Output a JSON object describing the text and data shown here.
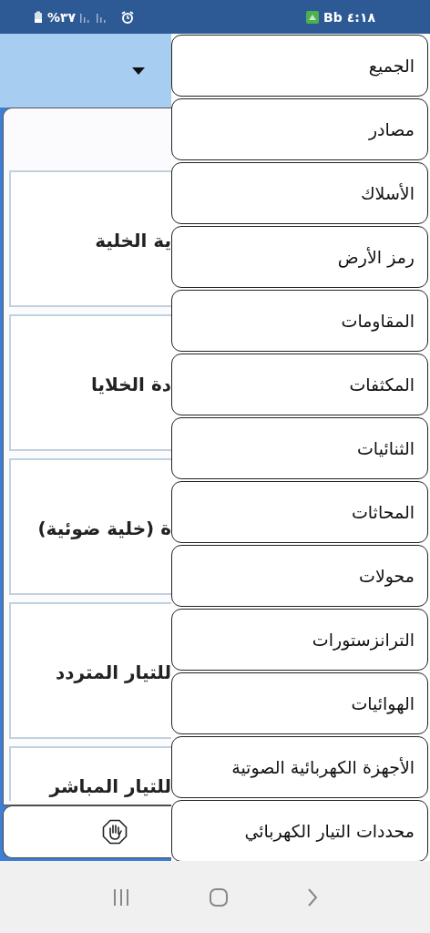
{
  "status_bar": {
    "time": "٤:١٨",
    "carrier": "Bb",
    "battery": "%٣٧"
  },
  "list": {
    "rows": [
      {
        "text": "ية الخلية"
      },
      {
        "text": "دة الخلايا"
      },
      {
        "text": "ة (خلية ضوئية)"
      },
      {
        "text": "للتيار المتردد"
      },
      {
        "text": "للتيار المباشر"
      }
    ]
  },
  "menu": {
    "items": [
      "الجميع",
      "مصادر",
      "الأسلاك",
      "رمز الأرض",
      "المقاومات",
      "المكثفات",
      "الثنائيات",
      "المحاثات",
      "محولات",
      "الترانزستورات",
      "الهوائيات",
      "الأجهزة الكهربائية الصوتية",
      "محددات التيار الكهربائي"
    ]
  }
}
